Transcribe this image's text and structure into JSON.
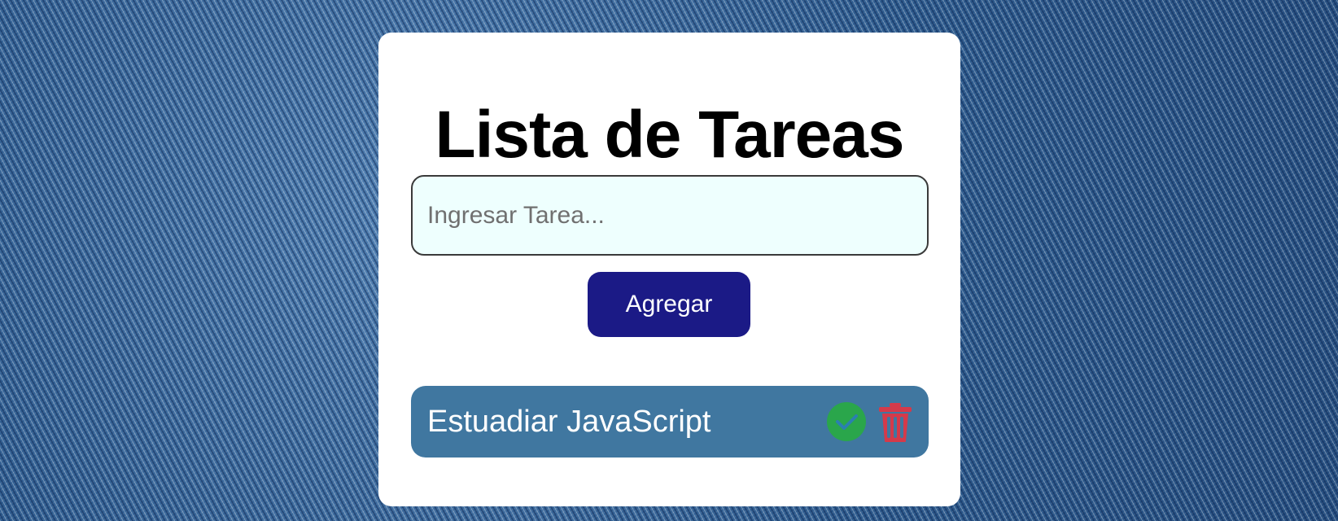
{
  "header": {
    "title": "Lista de Tareas"
  },
  "form": {
    "placeholder": "Ingresar Tarea...",
    "value": "",
    "add_label": "Agregar"
  },
  "tasks": [
    {
      "text": "Estuadiar JavaScript",
      "complete_icon": "check-circle-icon",
      "delete_icon": "trash-icon"
    }
  ],
  "colors": {
    "card_bg": "#ffffff",
    "input_bg": "#eefffe",
    "add_button_bg": "#1b1a86",
    "task_bg": "#4077a0",
    "complete_icon": "#2aa64b",
    "delete_icon": "#d43a4a"
  }
}
